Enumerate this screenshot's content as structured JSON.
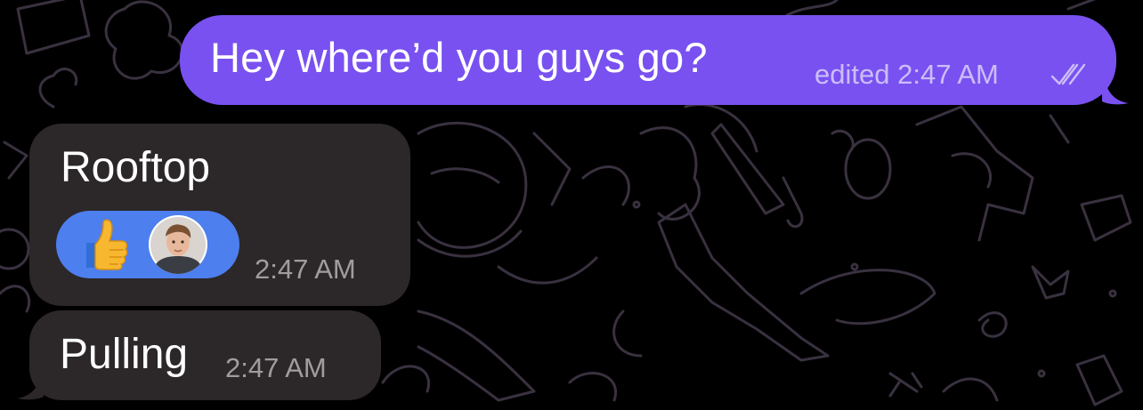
{
  "theme": {
    "background": "#000000",
    "outgoing_bubble_color": "#7951f0",
    "incoming_bubble_color": "#2c2729",
    "reaction_pill_color": "#4d7fef",
    "doodle_color": "#3a3140"
  },
  "messages": [
    {
      "direction": "outgoing",
      "text": "Hey where’d you guys go?",
      "status": "edited",
      "time": "2:47 AM",
      "read_icon": "double-check-icon"
    },
    {
      "direction": "incoming",
      "text": "Rooftop",
      "time": "2:47 AM",
      "reaction": {
        "emoji": "👍",
        "icon": "thumbs-up-icon",
        "reactor_avatar": "avatar"
      }
    },
    {
      "direction": "incoming",
      "text": "Pulling",
      "time": "2:47 AM"
    }
  ]
}
